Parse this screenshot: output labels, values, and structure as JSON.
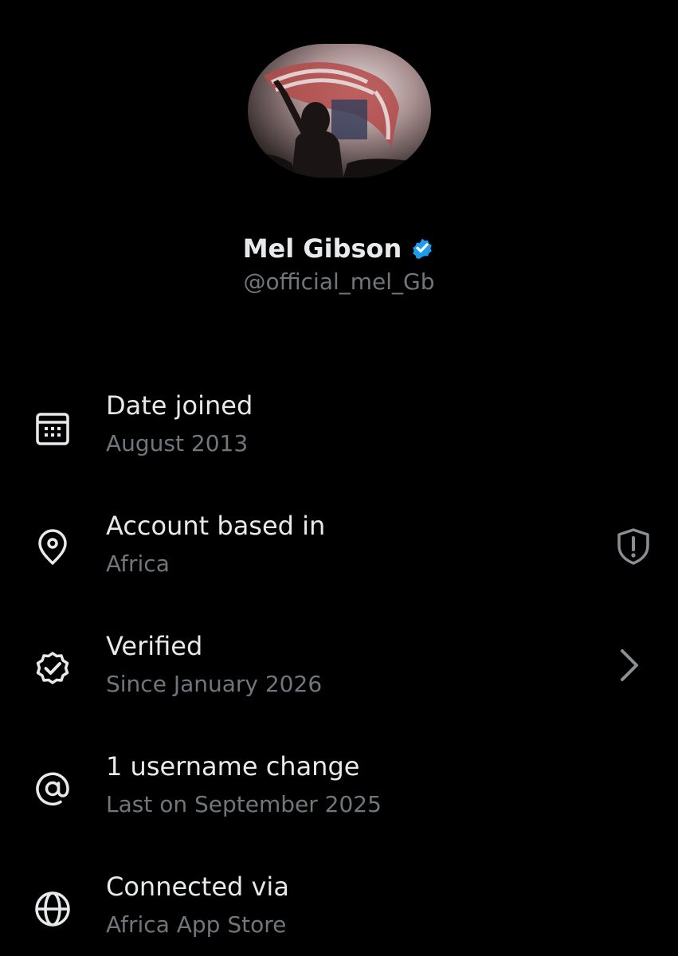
{
  "profile": {
    "name": "Mel Gibson",
    "handle": "@official_mel_Gb",
    "verified_color": "#1d9bf0"
  },
  "rows": [
    {
      "icon": "calendar-icon",
      "title": "Date joined",
      "subtitle": "August 2013"
    },
    {
      "icon": "location-pin-icon",
      "title": "Account based in",
      "subtitle": "Africa",
      "right_icon": "shield-alert-icon"
    },
    {
      "icon": "verified-badge-outline-icon",
      "title": "Verified",
      "subtitle": "Since January 2026",
      "right_icon": "chevron-right-icon"
    },
    {
      "icon": "at-sign-icon",
      "title": "1 username change",
      "subtitle": "Last on September 2025"
    },
    {
      "icon": "globe-icon",
      "title": "Connected via",
      "subtitle": "Africa App Store"
    }
  ],
  "colors": {
    "background": "#000000",
    "primary_text": "#e7e9ea",
    "secondary_text": "#71767b"
  }
}
